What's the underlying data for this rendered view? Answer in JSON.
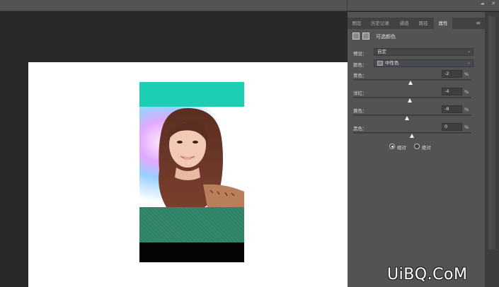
{
  "tabs": [
    "图层",
    "历史记录",
    "通道",
    "路径",
    "属性"
  ],
  "panel": {
    "title": "可选颜色",
    "preset_label": "预设：",
    "preset_value": "自定",
    "colors_label": "颜色：",
    "colors_value": "中性色",
    "sliders": [
      {
        "label": "青色：",
        "value": "-2",
        "unit": "%"
      },
      {
        "label": "洋红：",
        "value": "-4",
        "unit": "%"
      },
      {
        "label": "黄色：",
        "value": "-8",
        "unit": "%"
      },
      {
        "label": "黑色：",
        "value": "0",
        "unit": "%"
      }
    ],
    "method": {
      "relative_label": "相对",
      "absolute_label": "绝对",
      "selected": "relative"
    }
  },
  "watermark": "UiBQ.CoM",
  "colors": {
    "panel_bg": "#535353",
    "workspace_bg": "#282828",
    "teal": "#1dcfb2",
    "document_bg": "#ffffff"
  }
}
